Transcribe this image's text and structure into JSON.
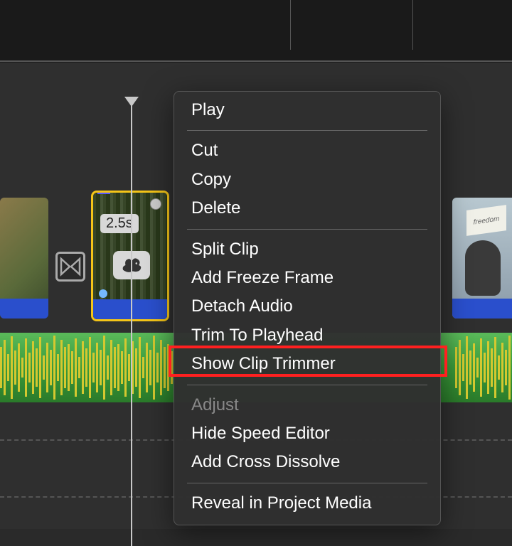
{
  "clip": {
    "duration_label": "2.5s",
    "freedom_text": "freedom"
  },
  "menu": {
    "play": "Play",
    "cut": "Cut",
    "copy": "Copy",
    "delete": "Delete",
    "split_clip": "Split Clip",
    "add_freeze_frame": "Add Freeze Frame",
    "detach_audio": "Detach Audio",
    "trim_to_playhead": "Trim To Playhead",
    "show_clip_trimmer": "Show Clip Trimmer",
    "adjust": "Adjust",
    "hide_speed_editor": "Hide Speed Editor",
    "add_cross_dissolve": "Add Cross Dissolve",
    "reveal_in_project_media": "Reveal in Project Media"
  },
  "highlighted_item": "show_clip_trimmer"
}
